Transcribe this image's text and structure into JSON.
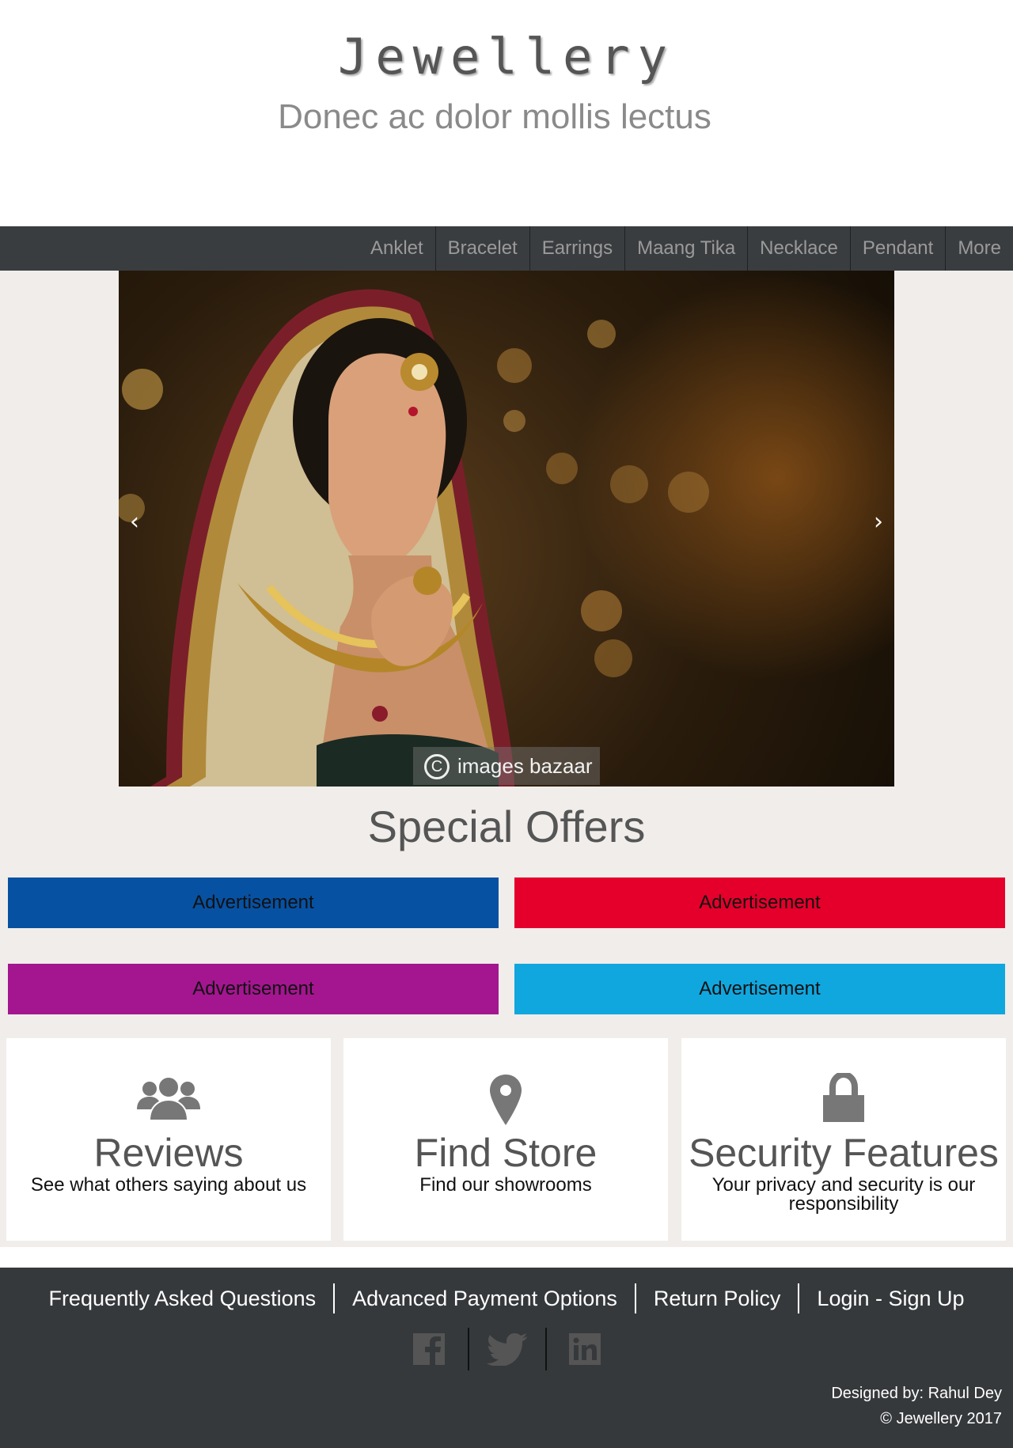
{
  "header": {
    "title": "Jewellery",
    "tagline": "Donec ac dolor mollis lectus"
  },
  "nav": {
    "items": [
      "Anklet",
      "Bracelet",
      "Earrings",
      "Maang Tika",
      "Necklace",
      "Pendant",
      "More"
    ]
  },
  "carousel": {
    "prev_label": "‹",
    "next_label": "›",
    "watermark": "images bazaar"
  },
  "offers": {
    "title": "Special Offers",
    "ads": [
      {
        "label": "Advertisement",
        "color": "#0751a2"
      },
      {
        "label": "Advertisement",
        "color": "#e4002b"
      },
      {
        "label": "Advertisement",
        "color": "#a3168f"
      },
      {
        "label": "Advertisement",
        "color": "#10a7df"
      }
    ]
  },
  "features": [
    {
      "icon": "users-icon",
      "title": "Reviews",
      "desc": "See what others saying about us"
    },
    {
      "icon": "map-pin-icon",
      "title": "Find Store",
      "desc": "Find our showrooms"
    },
    {
      "icon": "lock-icon",
      "title": "Security Features",
      "desc": "Your privacy and security is our responsibility"
    }
  ],
  "footer": {
    "links": [
      "Frequently Asked Questions",
      "Advanced Payment Options",
      "Return Policy",
      "Login - Sign Up"
    ],
    "social": [
      "facebook-icon",
      "twitter-icon",
      "linkedin-icon"
    ],
    "designer": "Designed by: Rahul Dey",
    "copyright": "© Jewellery 2017"
  },
  "colors": {
    "nav_bg": "#3a3d40",
    "footer_bg": "#36393c",
    "main_bg": "#f0edea",
    "icon_gray": "#777777"
  }
}
